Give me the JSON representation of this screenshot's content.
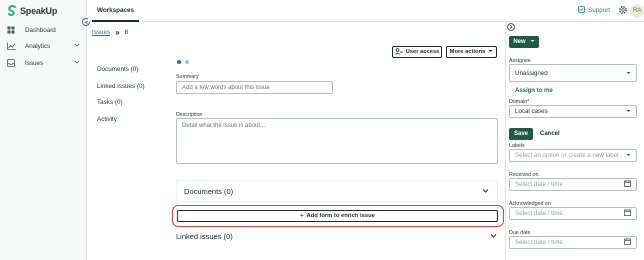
{
  "app": {
    "brand": "SpeakUp"
  },
  "sidebar": {
    "items": [
      {
        "label": "Dashboard",
        "icon": "grid-icon"
      },
      {
        "label": "Analytics",
        "icon": "chart-icon",
        "has_chevron": true
      },
      {
        "label": "Issues",
        "icon": "inbox-icon",
        "has_chevron": true
      }
    ]
  },
  "topbar": {
    "tab": "Workspaces",
    "support": "Support",
    "avatar_initials": "RA"
  },
  "breadcrumb": {
    "link": "Issues",
    "current": "8"
  },
  "actions": {
    "user_access": "User access",
    "more_actions": "More actions"
  },
  "content_nav": [
    "Documents (0)",
    "Linked issues (0)",
    "Tasks (0)",
    "Activity"
  ],
  "form": {
    "summary_label": "Summary",
    "summary_placeholder": "Add a few words about this issue",
    "description_label": "Description",
    "description_placeholder": "Detail what the issue is about..."
  },
  "sections": {
    "documents": "Documents (0)",
    "add_form": "Add form to enrich issue",
    "linked_issues": "Linked issues (0)"
  },
  "right_panel": {
    "new_button": "New",
    "assignee_label": "Assignee",
    "assignee_value": "Unassigned",
    "assign_to_me": "Assign to me",
    "domain_label": "Domain*",
    "domain_value": "Local cases",
    "save": "Save",
    "cancel": "Cancel",
    "labels_label": "Labels",
    "labels_placeholder": "Select an option or create a new label",
    "received_label": "Received on",
    "acknowledged_label": "Acknowledged on",
    "due_label": "Due date",
    "date_placeholder": "Select date / time"
  },
  "colors": {
    "accent": "#1f5a45",
    "link": "#1f6fb8",
    "highlight": "#e0463a"
  }
}
